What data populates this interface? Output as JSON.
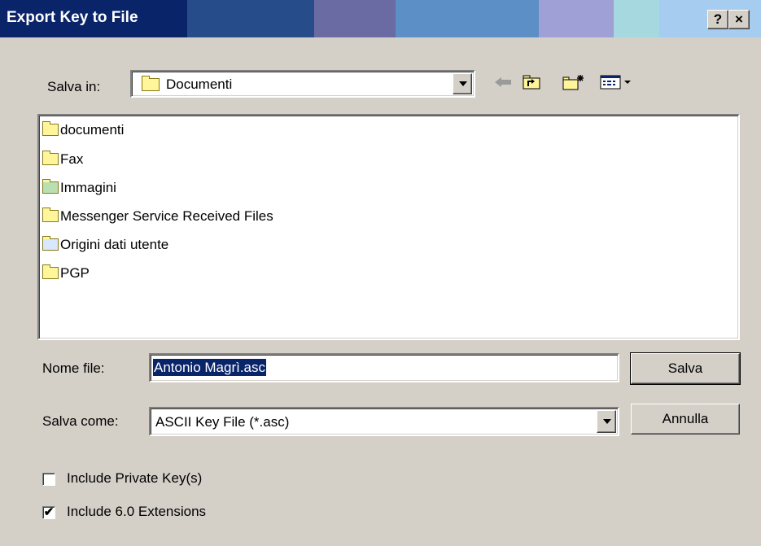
{
  "window": {
    "title": "Export Key to File",
    "help_label": "?",
    "close_label": "×"
  },
  "colors": {
    "title_gradient": [
      "#0a246a",
      "#264d8a",
      "#6b6ba3",
      "#5d8fc7",
      "#9fa0d5",
      "#a6d8e0",
      "#a6ccf0"
    ]
  },
  "toolbar": {
    "location_label": "Salva in:",
    "location_value": "Documenti",
    "back_icon": "back-arrow-icon",
    "up_icon": "up-folder-icon",
    "new_folder_icon": "new-folder-icon",
    "view_icon": "view-menu-icon"
  },
  "files": [
    {
      "name": "documenti",
      "icon": "folder-icon"
    },
    {
      "name": "Fax",
      "icon": "folder-icon"
    },
    {
      "name": "Immagini",
      "icon": "pictures-folder-icon"
    },
    {
      "name": "Messenger Service Received Files",
      "icon": "folder-icon"
    },
    {
      "name": "Origini dati utente",
      "icon": "data-sources-folder-icon"
    },
    {
      "name": "PGP",
      "icon": "folder-icon"
    }
  ],
  "filename": {
    "label": "Nome file:",
    "value": "Antonio Magrì.asc"
  },
  "filetype": {
    "label": "Salva come:",
    "value": "ASCII Key File (*.asc)"
  },
  "buttons": {
    "save": "Salva",
    "cancel": "Annulla"
  },
  "options": {
    "private_keys": {
      "label": "Include Private Key(s)",
      "checked": false
    },
    "extensions": {
      "label": "Include 6.0 Extensions",
      "checked": true,
      "mark": "✔"
    }
  }
}
